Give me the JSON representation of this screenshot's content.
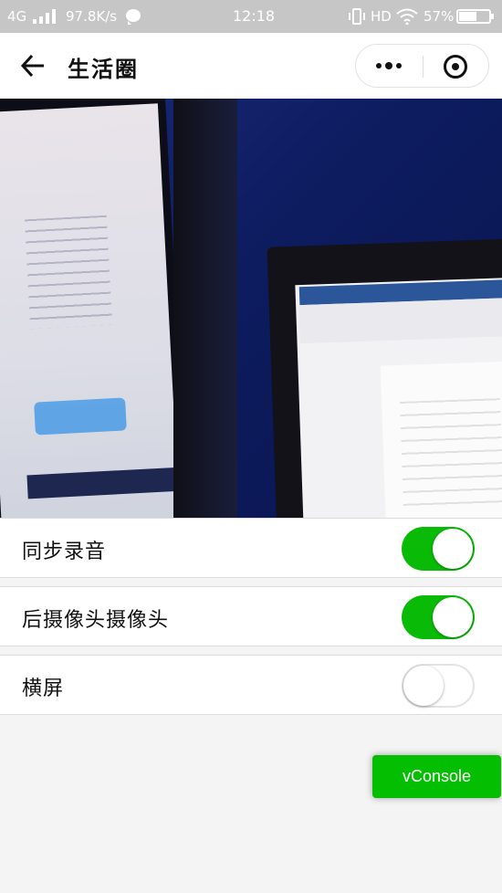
{
  "status_bar": {
    "network": "4G",
    "speed": "97.8K/s",
    "time": "12:18",
    "hd": "HD",
    "battery_pct": "57%",
    "battery_level": 0.57
  },
  "nav": {
    "title": "生活圈"
  },
  "settings": {
    "items": [
      {
        "label": "同步录音",
        "enabled": true
      },
      {
        "label": "后摄像头摄像头",
        "enabled": true
      },
      {
        "label": "横屏",
        "enabled": false
      }
    ]
  },
  "vconsole": {
    "label": "vConsole"
  },
  "colors": {
    "accent": "#09bb07",
    "vconsole": "#04be02",
    "status_bar": "#c6c6c6"
  }
}
